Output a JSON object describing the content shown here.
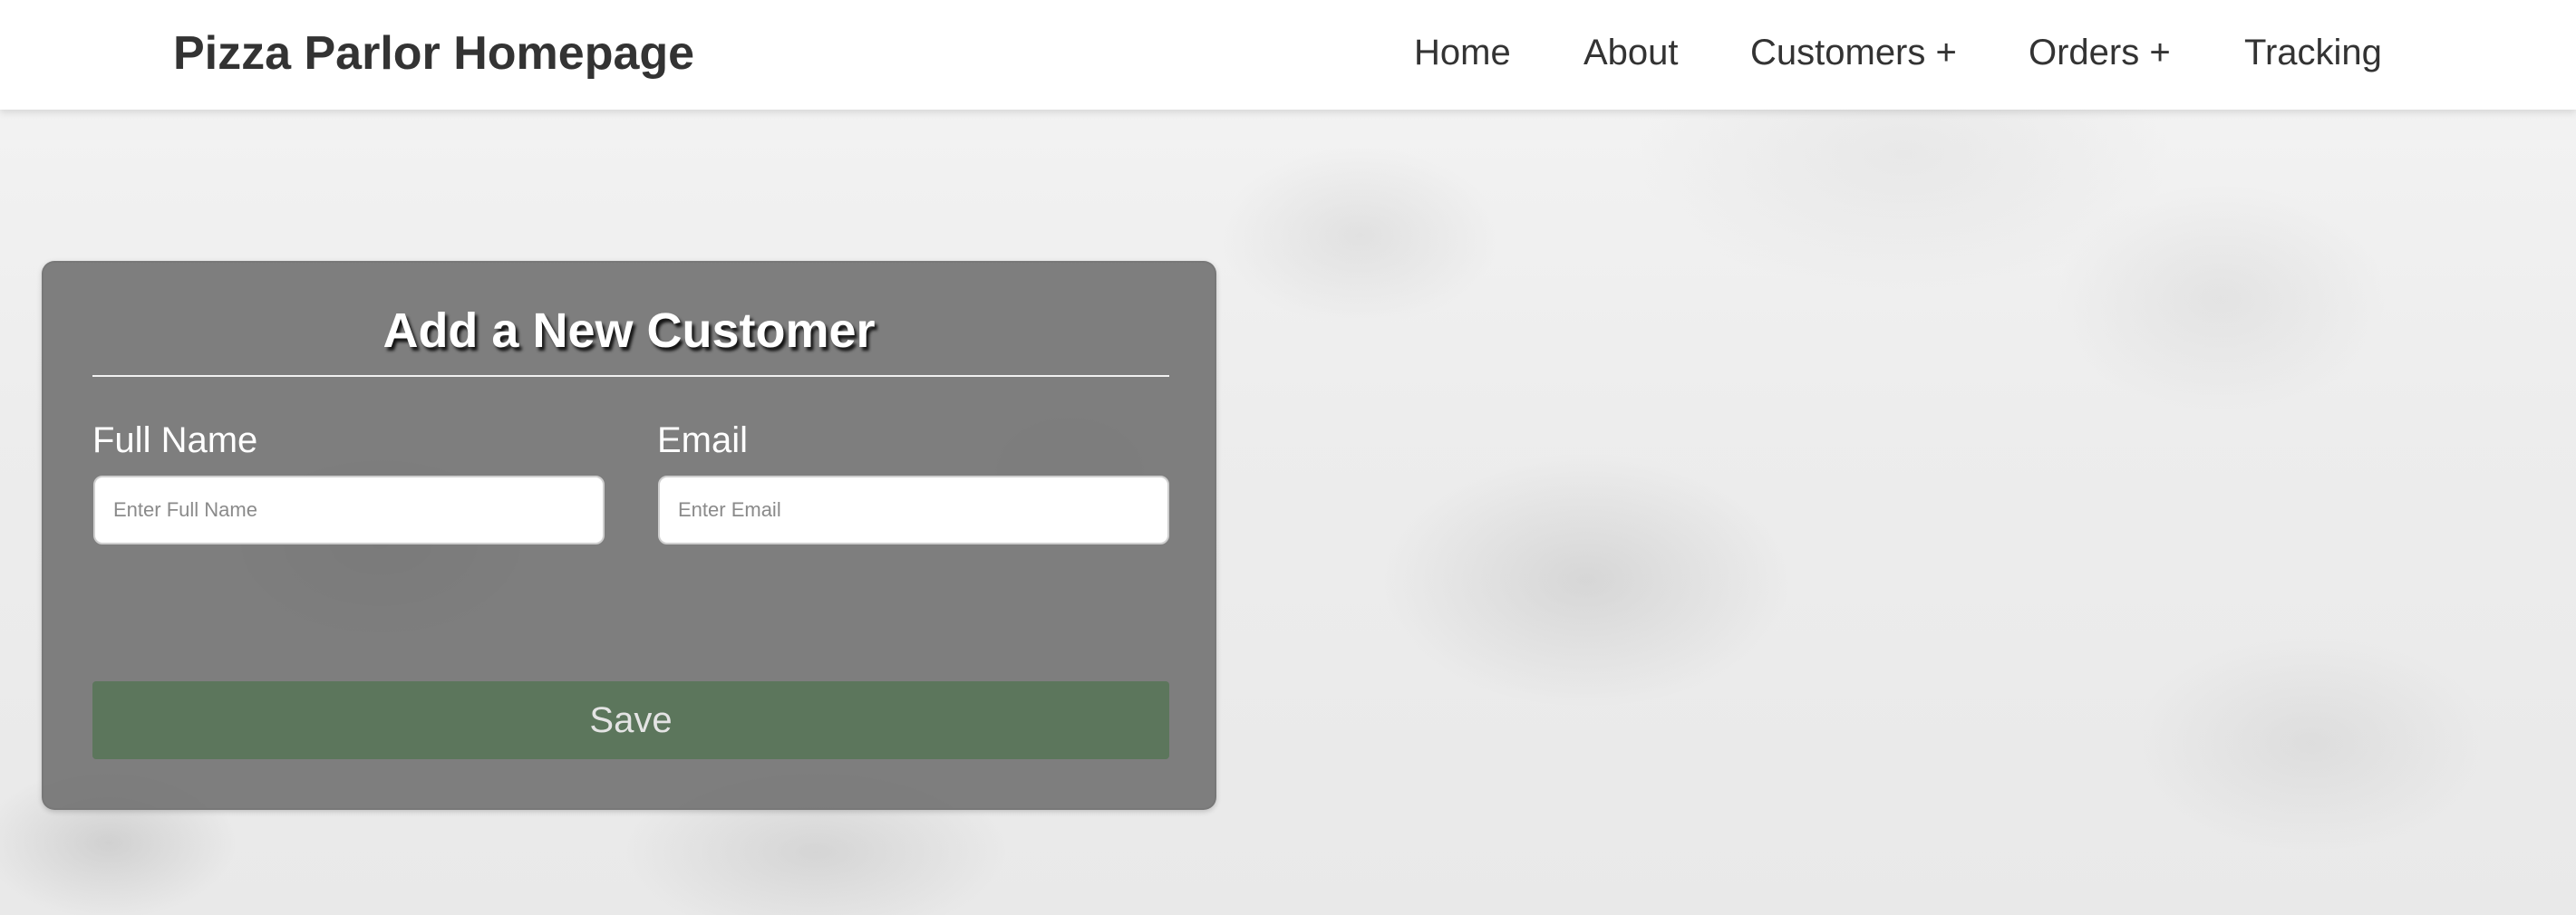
{
  "header": {
    "brand": "Pizza Parlor Homepage",
    "nav": {
      "home": "Home",
      "about": "About",
      "customers": "Customers +",
      "orders": "Orders +",
      "tracking": "Tracking"
    }
  },
  "form": {
    "title": "Add a New Customer",
    "full_name": {
      "label": "Full Name",
      "placeholder": "Enter Full Name",
      "value": ""
    },
    "email": {
      "label": "Email",
      "placeholder": "Enter Email",
      "value": ""
    },
    "save_label": "Save"
  },
  "colors": {
    "card_background": "#6e6e6e",
    "save_button": "#5c765c",
    "header_text": "#333333"
  }
}
